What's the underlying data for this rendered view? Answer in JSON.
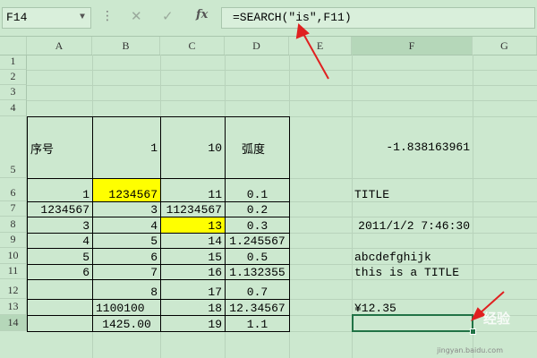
{
  "toolbar": {
    "name_box": "F14",
    "formula": "=SEARCH(\"is\",F11)",
    "cancel_icon": "cancel-icon",
    "enter_icon": "check-icon",
    "fx_label": "fx"
  },
  "columns": [
    "A",
    "B",
    "C",
    "D",
    "E",
    "F",
    "G"
  ],
  "rows": [
    "1",
    "2",
    "3",
    "9",
    "4",
    "5",
    "6",
    "7",
    "8",
    "9",
    "10",
    "11",
    "12",
    "13",
    "14"
  ],
  "cells": {
    "A5": "序号",
    "B5": "1",
    "C5": "10",
    "D5": "弧度",
    "F5": "-1.838163961",
    "A6": "1",
    "B6": "1234567",
    "C6": "11",
    "D6": "0.1",
    "F6": "TITLE",
    "A7": "1234567",
    "B7": "3",
    "C7": "11234567",
    "D7": "0.2",
    "A8": "3",
    "B8": "4",
    "C8": "13",
    "D8": "0.3",
    "F8": "2011/1/2 7:46:30",
    "A9": "4",
    "B9": "5",
    "C9": "14",
    "D9": "1.245567",
    "A10": "5",
    "B10": "6",
    "C10": "15",
    "D10": "0.5",
    "F10": "abcdefghijk",
    "A11": "6",
    "B11": "7",
    "C11": "16",
    "D11": "1.132355",
    "F11": "this is a TITLE",
    "B12": "8",
    "C12": "17",
    "D12": "0.7",
    "B13": "1100100",
    "C13": "18",
    "D13": "12.34567",
    "F13": "¥12.35",
    "B14": "1425.00",
    "C14": "19",
    "D14": "1.1"
  },
  "watermark": "经验",
  "watermark_url": "jingyan.baidu.com",
  "colors": {
    "highlight": "#ffff00",
    "selection": "#217346",
    "arrow": "#e02020"
  }
}
